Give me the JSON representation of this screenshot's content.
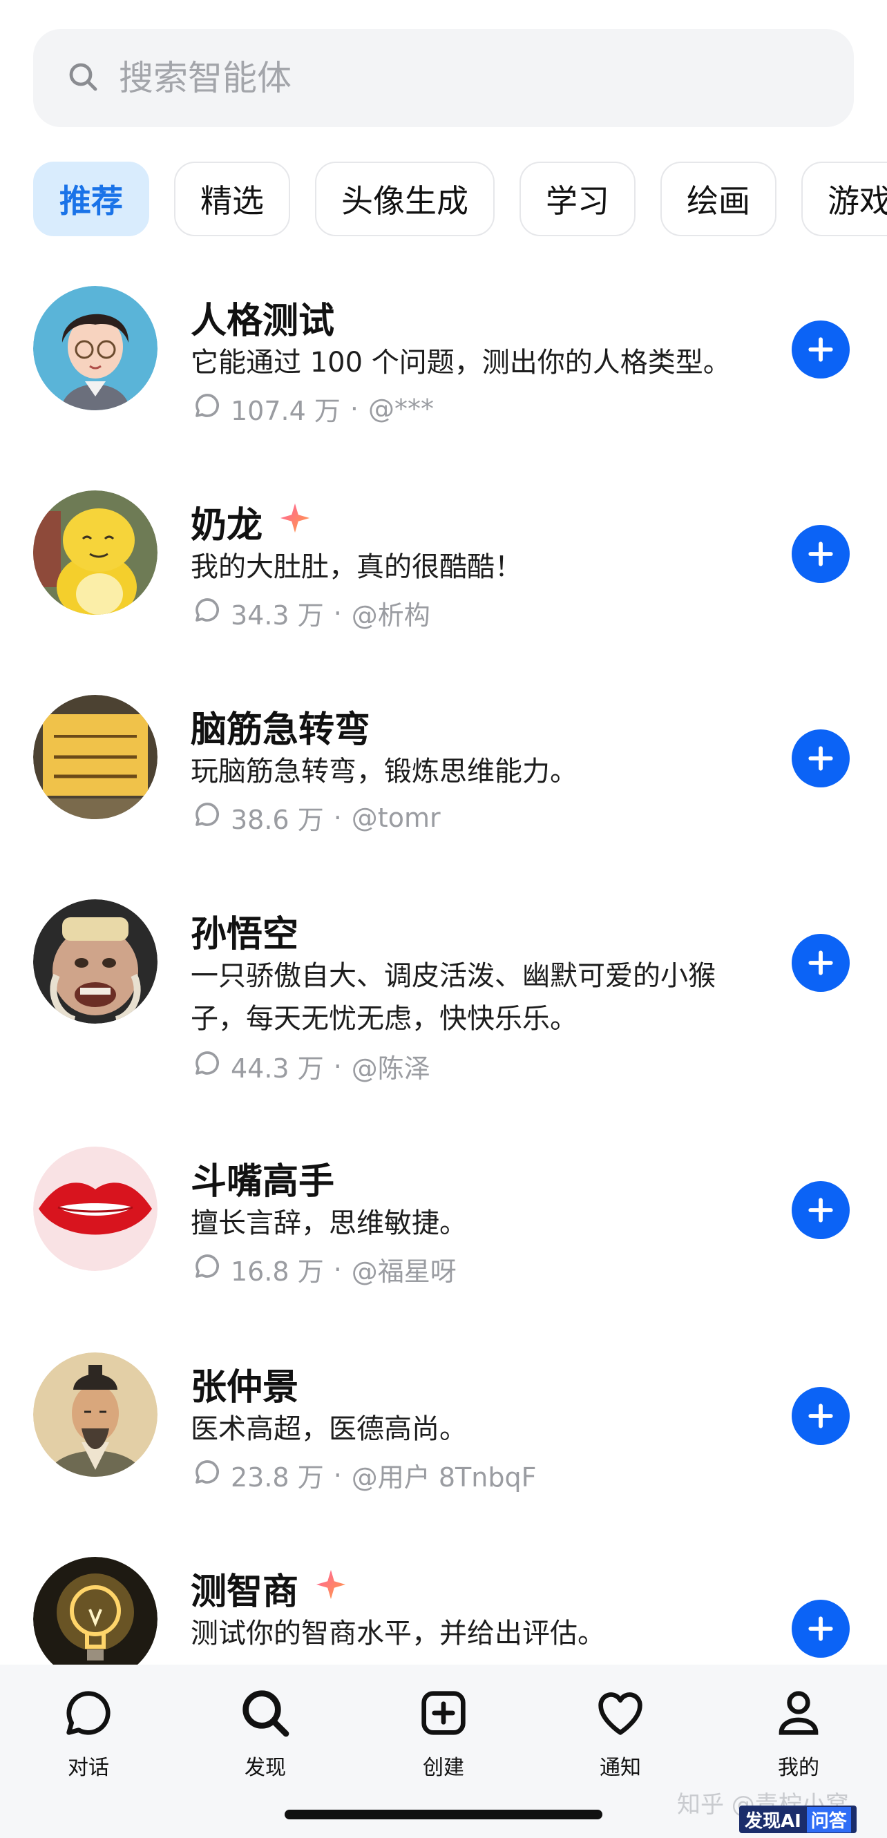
{
  "search": {
    "placeholder": "搜索智能体"
  },
  "tabs": [
    {
      "label": "推荐",
      "active": true
    },
    {
      "label": "精选",
      "active": false
    },
    {
      "label": "头像生成",
      "active": false
    },
    {
      "label": "学习",
      "active": false
    },
    {
      "label": "绘画",
      "active": false
    },
    {
      "label": "游戏",
      "active": false
    }
  ],
  "agents": [
    {
      "name": "人格测试",
      "description": "它能通过 100 个问题，测出你的人格类型。",
      "count": "107.4 万",
      "author": "@***",
      "sparkle": false,
      "avatar": "cartoon-person-avatar"
    },
    {
      "name": "奶龙",
      "description": "我的大肚肚，真的很酷酷！",
      "count": "34.3 万",
      "author": "@析构",
      "sparkle": true,
      "avatar": "yellow-dragon-avatar"
    },
    {
      "name": "脑筋急转弯",
      "description": "玩脑筋急转弯，锻炼思维能力。",
      "count": "38.6 万",
      "author": "@tomr",
      "sparkle": false,
      "avatar": "sign-board-avatar"
    },
    {
      "name": "孙悟空",
      "description": "一只骄傲自大、调皮活泼、幽默可爱的小猴子，每天无忧无虑，快快乐乐。",
      "count": "44.3 万",
      "author": "@陈泽",
      "sparkle": false,
      "avatar": "monkey-king-avatar"
    },
    {
      "name": "斗嘴高手",
      "description": "擅长言辞，思维敏捷。",
      "count": "16.8 万",
      "author": "@福星呀",
      "sparkle": false,
      "avatar": "red-lips-avatar"
    },
    {
      "name": "张仲景",
      "description": "医术高超，医德高尚。",
      "count": "23.8 万",
      "author": "@用户 8TnbqF",
      "sparkle": false,
      "avatar": "ancient-doctor-avatar"
    },
    {
      "name": "测智商",
      "description": "测试你的智商水平，并给出评估。",
      "count": "",
      "author": "",
      "sparkle": true,
      "avatar": "lightbulb-avatar"
    }
  ],
  "nav": [
    {
      "label": "对话",
      "icon": "chat-bubble-icon"
    },
    {
      "label": "发现",
      "icon": "search-icon"
    },
    {
      "label": "创建",
      "icon": "plus-square-icon"
    },
    {
      "label": "通知",
      "icon": "heart-icon"
    },
    {
      "label": "我的",
      "icon": "person-icon"
    }
  ],
  "watermark": "知乎 @青柠小窝",
  "badge": {
    "left": "发现AI",
    "right": "问答"
  },
  "colors": {
    "accent": "#0b63f6",
    "active_tab_bg": "#d9ecfd",
    "active_tab_text": "#1a73e8",
    "meta": "#9a9ca1"
  }
}
